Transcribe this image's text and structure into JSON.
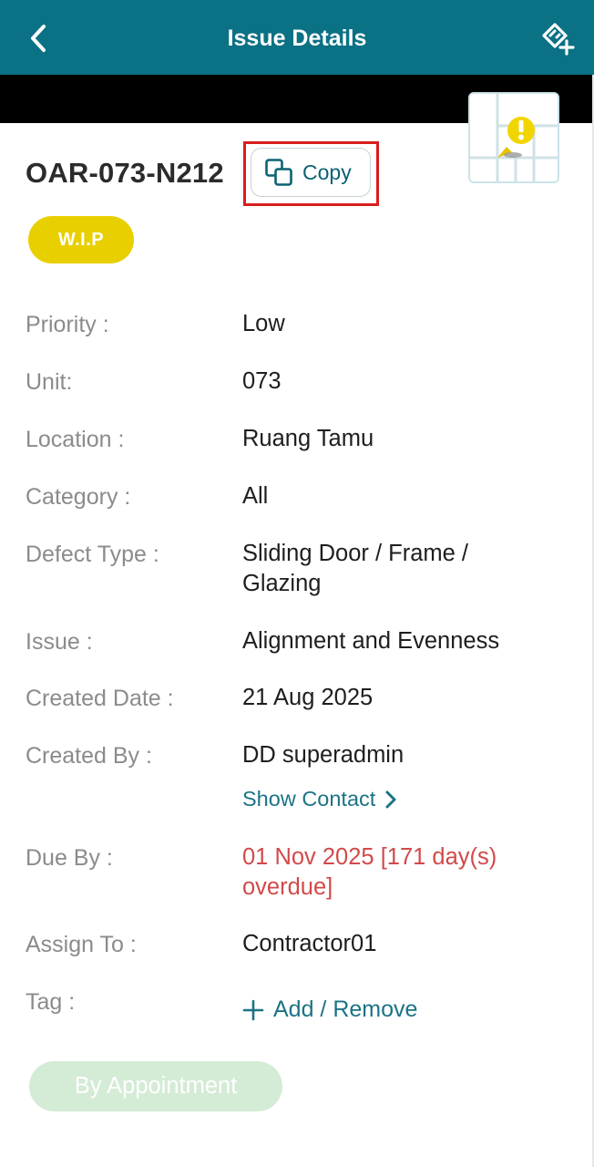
{
  "header": {
    "title": "Issue Details"
  },
  "issue": {
    "id": "OAR-073-N212",
    "copy_label": "Copy",
    "status": "W.I.P"
  },
  "details": {
    "priority": {
      "label": "Priority :",
      "value": "Low"
    },
    "unit": {
      "label": "Unit:",
      "value": "073"
    },
    "location": {
      "label": "Location :",
      "value": "Ruang Tamu"
    },
    "category": {
      "label": "Category :",
      "value": "All"
    },
    "defect_type": {
      "label": "Defect Type :",
      "value": "Sliding Door / Frame / Glazing"
    },
    "issue": {
      "label": "Issue :",
      "value": "Alignment and Evenness"
    },
    "created_date": {
      "label": "Created Date :",
      "value": "21 Aug 2025"
    },
    "created_by": {
      "label": "Created By :",
      "value": "DD superadmin"
    },
    "show_contact_label": "Show Contact",
    "due_by": {
      "label": "Due By :",
      "value": "01 Nov 2025 [171 day(s) overdue]"
    },
    "assign_to": {
      "label": "Assign To :",
      "value": "Contractor01"
    },
    "tag": {
      "label": "Tag :",
      "action_label": "Add / Remove"
    }
  },
  "appointment_button": "By Appointment",
  "icons": {
    "back": "chevron-left-icon",
    "header_action": "diamond-add-icon",
    "copy": "copy-icon",
    "map": "floor-plan-pin-icon",
    "show_contact": "chevron-right-icon",
    "add": "plus-icon"
  },
  "colors": {
    "header_bg": "#0b7185",
    "status_badge": "#e8cf00",
    "overdue": "#d24a4a",
    "link": "#1c7385",
    "appointment_bg": "#d4ebd6",
    "highlight_box": "#d81e1e"
  }
}
